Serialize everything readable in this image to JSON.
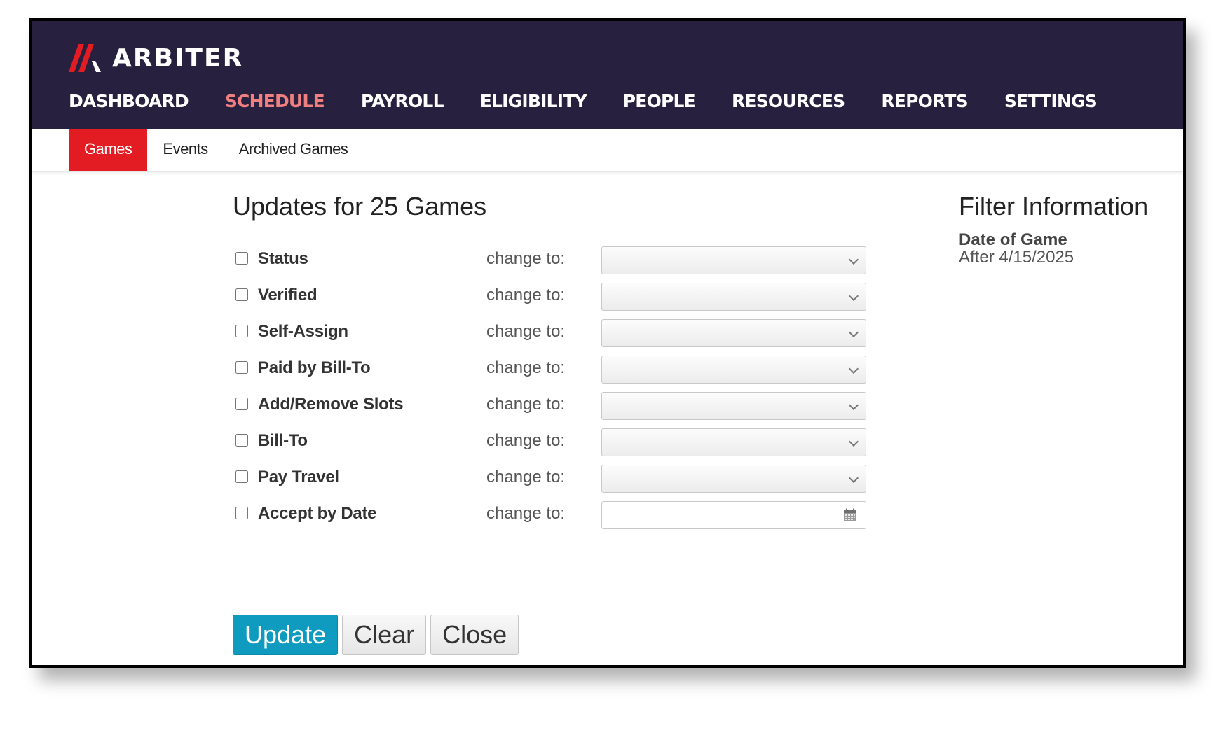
{
  "brand": {
    "name": "ARBITER",
    "colors": {
      "nav_bg": "#27213f",
      "accent_red": "#e31b23",
      "active_nav": "#f07f7f",
      "primary_button": "#0f9bbf"
    }
  },
  "nav": {
    "items": [
      {
        "label": "DASHBOARD",
        "active": false
      },
      {
        "label": "SCHEDULE",
        "active": true
      },
      {
        "label": "PAYROLL",
        "active": false
      },
      {
        "label": "ELIGIBILITY",
        "active": false
      },
      {
        "label": "PEOPLE",
        "active": false
      },
      {
        "label": "RESOURCES",
        "active": false
      },
      {
        "label": "REPORTS",
        "active": false
      },
      {
        "label": "SETTINGS",
        "active": false
      }
    ]
  },
  "subnav": {
    "tabs": [
      {
        "label": "Games",
        "active": true
      },
      {
        "label": "Events",
        "active": false
      },
      {
        "label": "Archived Games",
        "active": false
      }
    ]
  },
  "form": {
    "title": "Updates for 25 Games",
    "change_to_label": "change to:",
    "rows": [
      {
        "label": "Status",
        "type": "select",
        "value": ""
      },
      {
        "label": "Verified",
        "type": "select",
        "value": ""
      },
      {
        "label": "Self-Assign",
        "type": "select",
        "value": ""
      },
      {
        "label": "Paid by Bill-To",
        "type": "select",
        "value": ""
      },
      {
        "label": "Add/Remove Slots",
        "type": "select",
        "value": ""
      },
      {
        "label": "Bill-To",
        "type": "select",
        "value": ""
      },
      {
        "label": "Pay Travel",
        "type": "select",
        "value": ""
      },
      {
        "label": "Accept by Date",
        "type": "date",
        "value": ""
      }
    ]
  },
  "filter": {
    "title": "Filter Information",
    "label": "Date of Game",
    "value": "After 4/15/2025"
  },
  "buttons": {
    "update": "Update",
    "clear": "Clear",
    "close": "Close"
  }
}
